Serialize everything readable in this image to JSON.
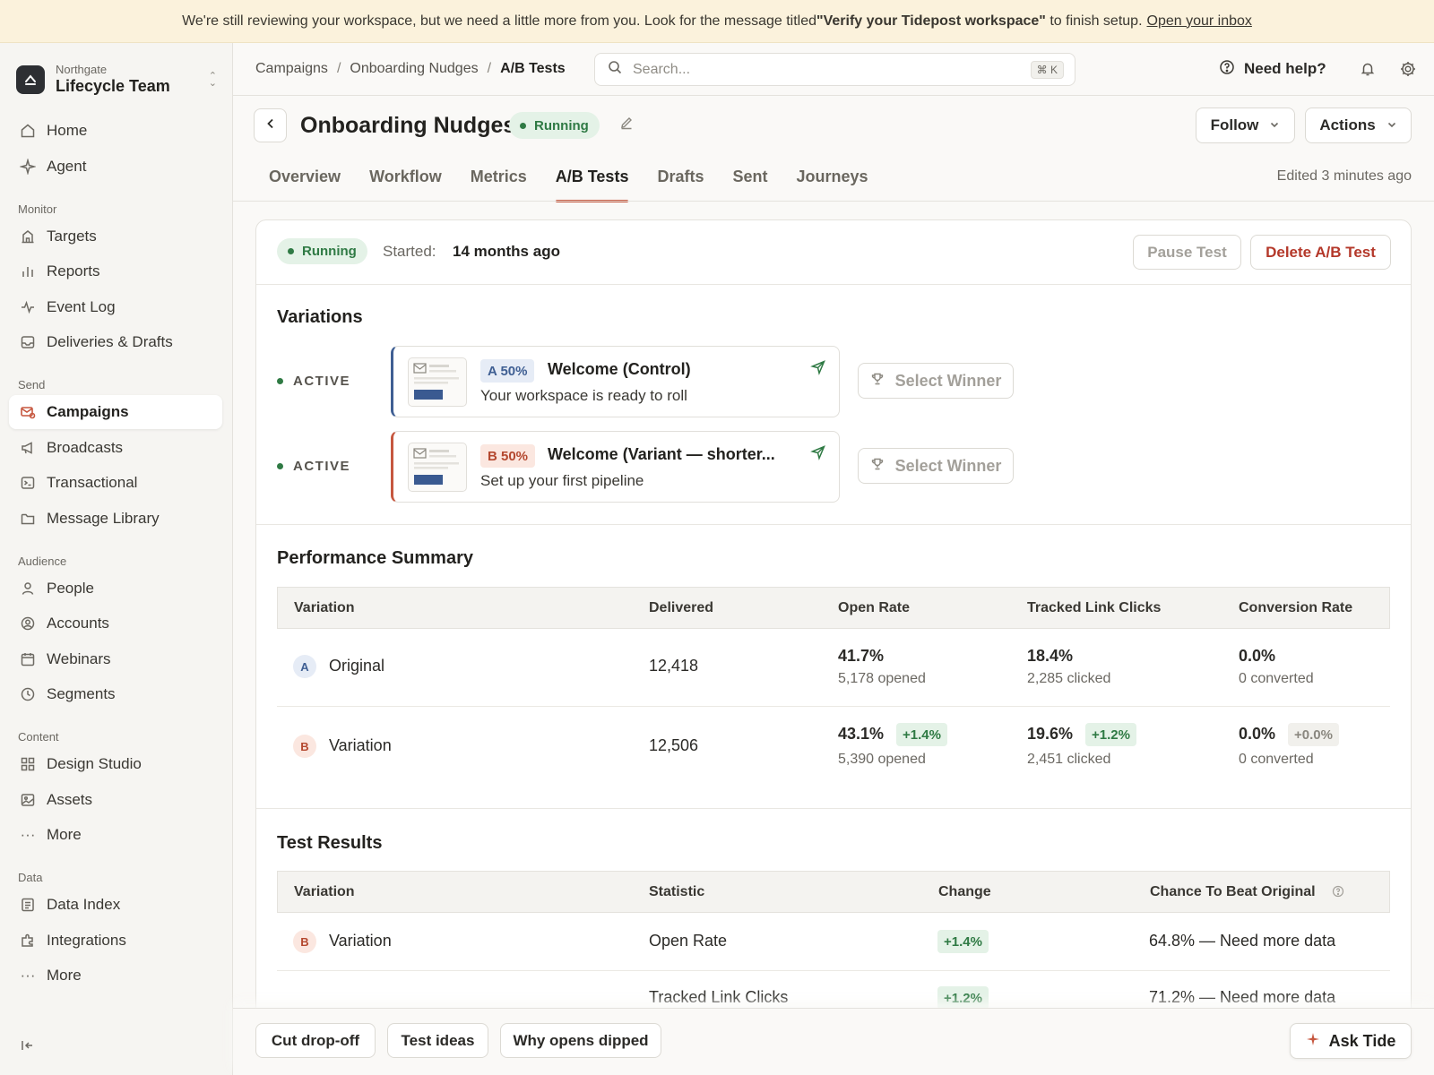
{
  "banner": {
    "text_before": "We're still reviewing your workspace, but we need a little more from you. Look for the message titled ",
    "highlight": "\"Verify your Tidepost workspace\"",
    "text_after": " to finish setup.",
    "link": "Open your inbox"
  },
  "workspace": {
    "org": "Northgate",
    "team": "Lifecycle Team"
  },
  "sidebar": {
    "home": "Home",
    "agent": "Agent",
    "monitor_label": "Monitor",
    "targets": "Targets",
    "reports": "Reports",
    "event_log": "Event Log",
    "deliveries": "Deliveries & Drafts",
    "send_label": "Send",
    "campaigns": "Campaigns",
    "broadcasts": "Broadcasts",
    "transactional": "Transactional",
    "message_library": "Message Library",
    "audience_label": "Audience",
    "people": "People",
    "accounts": "Accounts",
    "webinars": "Webinars",
    "segments": "Segments",
    "content_label": "Content",
    "design_studio": "Design Studio",
    "assets": "Assets",
    "more_content": "More",
    "data_label": "Data",
    "data_index": "Data Index",
    "integrations": "Integrations",
    "more_data": "More"
  },
  "header": {
    "breadcrumb": [
      "Campaigns",
      "Onboarding Nudges",
      "A/B Tests"
    ],
    "search_placeholder": "Search...",
    "search_shortcut": "⌘ K",
    "help": "Need help?"
  },
  "title": {
    "name": "Onboarding Nudges",
    "status": "Running",
    "follow": "Follow",
    "actions": "Actions"
  },
  "tabs": [
    "Overview",
    "Workflow",
    "Metrics",
    "A/B Tests",
    "Drafts",
    "Sent",
    "Journeys"
  ],
  "edited": "Edited 3 minutes ago",
  "test": {
    "status": "Running",
    "started_label": "Started:",
    "started_value": "14 months ago",
    "pause": "Pause Test",
    "delete": "Delete A/B Test"
  },
  "variations": {
    "title": "Variations",
    "items": [
      {
        "status": "ACTIVE",
        "tag": "A 50%",
        "name": "Welcome (Control)",
        "subject": "Your workspace is ready to roll",
        "select": "Select Winner"
      },
      {
        "status": "ACTIVE",
        "tag": "B 50%",
        "name": "Welcome (Variant — shorter...",
        "subject": "Set up your first pipeline",
        "select": "Select Winner"
      }
    ]
  },
  "performance": {
    "title": "Performance Summary",
    "columns": [
      "Variation",
      "Delivered",
      "Open Rate",
      "Tracked Link Clicks",
      "Conversion Rate"
    ],
    "rows": [
      {
        "letter": "A",
        "name": "Original",
        "delivered": "12,418",
        "open_rate": "41.7%",
        "opened": "5,178 opened",
        "clicks": "18.4%",
        "clicked": "2,285 clicked",
        "conversion": "0.0%",
        "converted": "0 converted"
      },
      {
        "letter": "B",
        "name": "Variation",
        "delivered": "12,506",
        "open_rate": "43.1%",
        "open_delta": "+1.4%",
        "opened": "5,390 opened",
        "clicks": "19.6%",
        "clicks_delta": "+1.2%",
        "clicked": "2,451 clicked",
        "conversion": "0.0%",
        "conversion_delta": "+0.0%",
        "converted": "0 converted"
      }
    ]
  },
  "results": {
    "title": "Test Results",
    "columns": [
      "Variation",
      "Statistic",
      "Change",
      "Chance To Beat Original"
    ],
    "rows": [
      {
        "letter": "B",
        "name": "Variation",
        "statistic": "Open Rate",
        "change": "+1.4%",
        "chance": "64.8% — Need more data"
      },
      {
        "statistic": "Tracked Link Clicks",
        "change": "+1.2%",
        "chance": "71.2% — Need more data"
      }
    ]
  },
  "suggestions": [
    "Cut drop-off",
    "Test ideas",
    "Why opens dipped"
  ],
  "ask": "Ask Tide",
  "colors": {
    "accent": "#c6573f",
    "success": "#2f7a44",
    "variant_a": "#3f5f93",
    "variant_b": "#b4482f",
    "danger": "#b4382a"
  }
}
